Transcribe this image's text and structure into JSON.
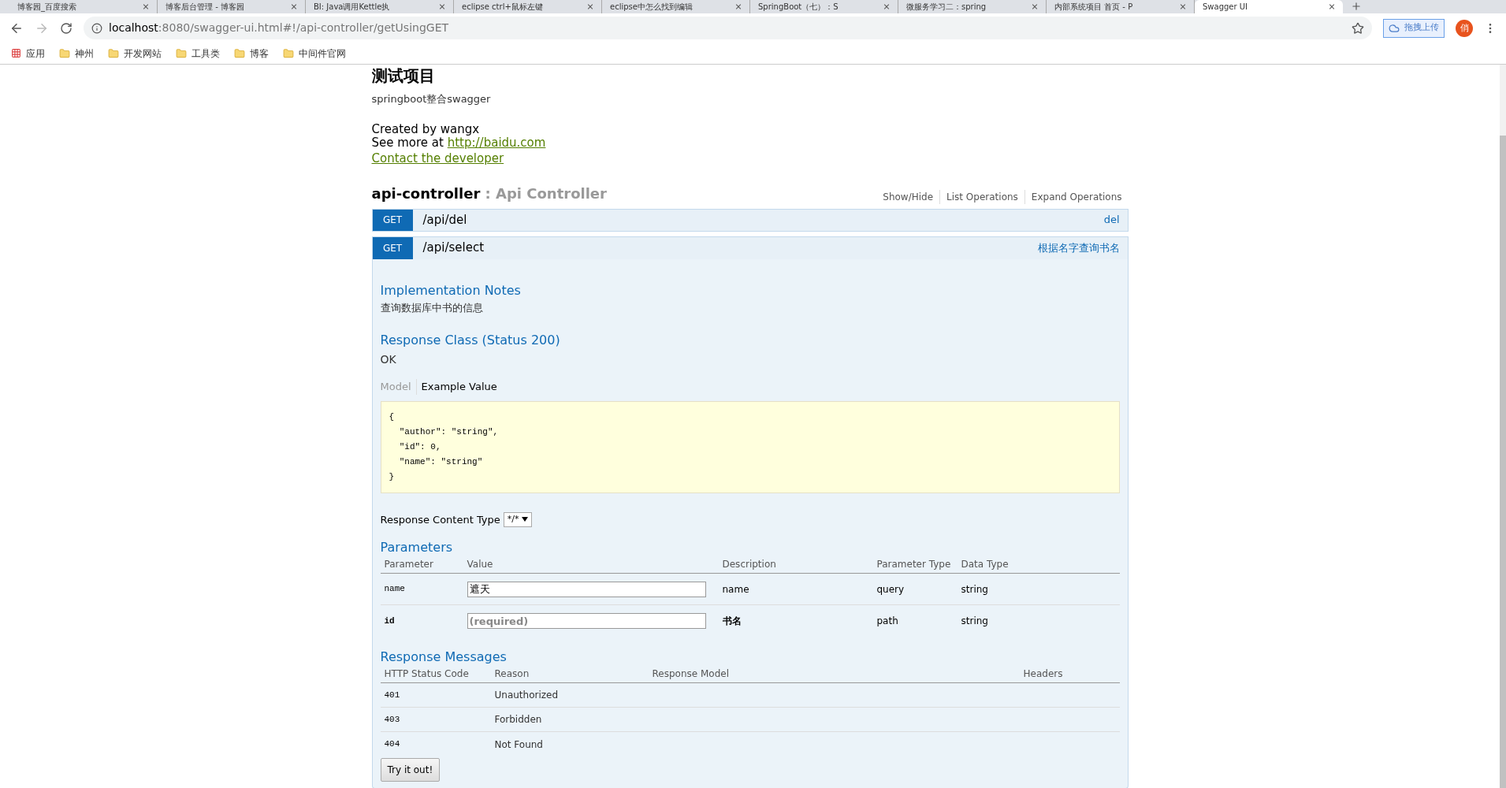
{
  "browser": {
    "tabs": [
      {
        "title": "博客园_百度搜索",
        "selected": false
      },
      {
        "title": "博客后台管理 - 博客园",
        "selected": false
      },
      {
        "title": "BI: Java调用Kettle执",
        "selected": false
      },
      {
        "title": "eclipse ctrl+鼠标左键",
        "selected": false
      },
      {
        "title": "eclipse中怎么找到编辑",
        "selected": false
      },
      {
        "title": "SpringBoot（七）：S",
        "selected": false
      },
      {
        "title": "微服务学习二：spring",
        "selected": false
      },
      {
        "title": "内部系统项目 首页 - P",
        "selected": false
      },
      {
        "title": "Swagger UI",
        "selected": true
      }
    ],
    "url_host": "localhost",
    "url_rest": ":8080/swagger-ui.html#!/api-controller/getUsingGET",
    "extension_button": "拖拽上传",
    "profile": "俏",
    "bookmarks": [
      {
        "label": "应用",
        "kind": "apps"
      },
      {
        "label": "神州",
        "kind": "folder"
      },
      {
        "label": "开发网站",
        "kind": "folder"
      },
      {
        "label": "工具类",
        "kind": "folder"
      },
      {
        "label": "博客",
        "kind": "folder"
      },
      {
        "label": "中间件官网",
        "kind": "folder"
      }
    ]
  },
  "info": {
    "title": "测试项目",
    "description": "springboot整合swagger",
    "created_by": "Created by wangx",
    "see_more": "See more at ",
    "link": "http://baidu.com",
    "contact": "Contact the developer"
  },
  "resource": {
    "name": "api-controller",
    "description": " : Api Controller",
    "actions": [
      "Show/Hide",
      "List Operations",
      "Expand Operations"
    ]
  },
  "operations": [
    {
      "method": "GET",
      "path": "/api/del",
      "summary": "del",
      "expanded": false
    },
    {
      "method": "GET",
      "path": "/api/select",
      "summary": "根据名字查询书名",
      "expanded": true,
      "notes_title": "Implementation Notes",
      "notes": "查询数据库中书的信息",
      "response_class_title": "Response Class (Status 200)",
      "response_class": "OK",
      "model_tabs": [
        {
          "label": "Model",
          "selected": false
        },
        {
          "label": "Example Value",
          "selected": true
        }
      ],
      "example_lines": [
        "{",
        "  \"author\": \"string\",",
        "  \"id\": 0,",
        "  \"name\": \"string\"",
        "}"
      ],
      "content_type_label": "Response Content Type",
      "content_type": "*/*",
      "parameters_title": "Parameters",
      "parameter_columns": [
        "Parameter",
        "Value",
        "Description",
        "Parameter Type",
        "Data Type"
      ],
      "parameters": [
        {
          "name": "name",
          "value": "遮天",
          "description": "name",
          "type": "query",
          "data_type": "string",
          "required": false
        },
        {
          "name": "id",
          "placeholder": "(required)",
          "description": "书名",
          "type": "path",
          "data_type": "string",
          "required": true
        }
      ],
      "messages_title": "Response Messages",
      "message_columns": [
        "HTTP Status Code",
        "Reason",
        "Response Model",
        "Headers"
      ],
      "messages": [
        {
          "code": "401",
          "reason": "Unauthorized"
        },
        {
          "code": "403",
          "reason": "Forbidden"
        },
        {
          "code": "404",
          "reason": "Not Found"
        }
      ],
      "try_button": "Try it out!"
    }
  ]
}
